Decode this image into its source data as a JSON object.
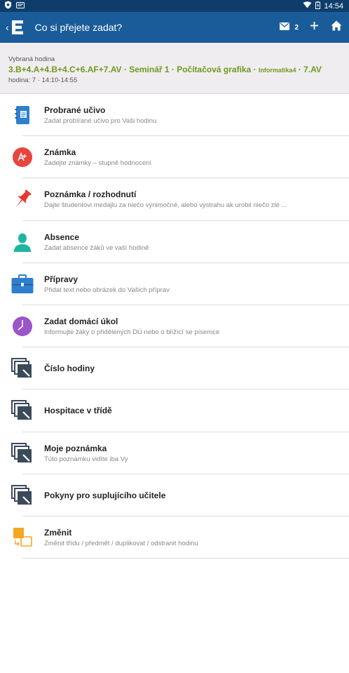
{
  "status_bar": {
    "time": "14:54"
  },
  "app_bar": {
    "logo": "E",
    "title": "Co si přejete zadat?",
    "mail_count": "2"
  },
  "lesson": {
    "label": "Vybraná hodina",
    "title_main": "3.B+4.A+4.B+4.C+6.AF+7.AV · Seminář 1 · Počítačová grafika · ",
    "title_small": "Informatika4",
    "title_end": " · 7.AV",
    "time": "hodina: 7 · 14:10-14:55"
  },
  "colors": {
    "app_bar": "#1a5c99",
    "status_bar": "#0f3d6b",
    "accent_green": "#6e9a1c",
    "header_bg": "#f0edf0"
  },
  "menu": [
    {
      "title": "Probrané učivo",
      "subtitle": "Zadat probírané učivo pro Vaši hodinu",
      "icon": "notebook-icon"
    },
    {
      "title": "Známka",
      "subtitle": "Zadejte známky – stupně hodnocení",
      "icon": "grade-icon"
    },
    {
      "title": "Poznámka / rozhodnutí",
      "subtitle": "Dajte študentovi medajlu za niečo výnimočné, alebo výstrahu ak urobil niečo zlé ...",
      "icon": "pin-icon"
    },
    {
      "title": "Absence",
      "subtitle": "Zadat absence žáků ve vaší hodině",
      "icon": "person-icon"
    },
    {
      "title": "Přípravy",
      "subtitle": "Přidat text nebo obrázek do Vašich příprav",
      "icon": "briefcase-icon"
    },
    {
      "title": "Zadat domácí úkol",
      "subtitle": "Informujte žáky o přidělených DÚ nebo o blížící se písemce",
      "icon": "clock-icon"
    },
    {
      "title": "Číslo hodiny",
      "subtitle": "",
      "icon": "edit-stack-icon"
    },
    {
      "title": "Hospitace v třídě",
      "subtitle": "",
      "icon": "edit-stack-icon"
    },
    {
      "title": "Moje poznámka",
      "subtitle": "Túto poznámku vidíte iba Vy",
      "icon": "edit-stack-icon"
    },
    {
      "title": "Pokyny pro suplujícího učitele",
      "subtitle": "",
      "icon": "edit-stack-icon"
    },
    {
      "title": "Změnit",
      "subtitle": "Změnit třídu / předmět / duplikovat / odstranit hodinu",
      "icon": "swap-icon"
    }
  ]
}
